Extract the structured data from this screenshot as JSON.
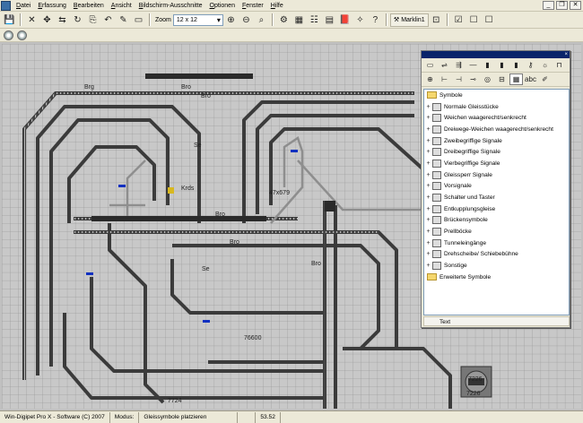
{
  "menu": {
    "items": [
      "Datei",
      "Erfassung",
      "Bearbeiten",
      "Ansicht",
      "Bildschirm-Ausschnitte",
      "Optionen",
      "Fenster",
      "Hilfe"
    ],
    "controls": [
      "_",
      "❐",
      "✕"
    ]
  },
  "toolbar": {
    "zoom_label": "Zoom",
    "zoom_value": "12 x 12",
    "marklin_label": "Marklin1"
  },
  "layout": {
    "labels": [
      "Bro",
      "Bro",
      "Brg",
      "Se",
      "Krds",
      "Bro",
      "Bro",
      "Se",
      "76600",
      "Bro",
      "7226",
      "7226",
      "7724",
      "47x679"
    ]
  },
  "palette": {
    "close": "×",
    "section1": "Symbole",
    "items": [
      "Normale Gleisstücke",
      "Weichen waagerecht/senkrecht",
      "Dreiwege-Weichen waagerecht/senkrecht",
      "Zweibegriffige Signale",
      "Dreibegriffige Signale",
      "Vierbegriffige Signale",
      "Gleissperr Signale",
      "Vorsignale",
      "Schalter und Taster",
      "Entkupplungsgleise",
      "Brückensymbole",
      "Prellböcke",
      "Tunneleingänge",
      "Drehscheibe/ Schiebebühne",
      "Sonstige"
    ],
    "section2": "Erweiterte Symbole",
    "text_label": "Text",
    "abc_label": "abc"
  },
  "status": {
    "app": "Win-Digipet Pro X - Software (C) 2007",
    "modus_label": "Modus:",
    "modus_value": "Gleissymbole platzieren",
    "coord": "53.52"
  }
}
